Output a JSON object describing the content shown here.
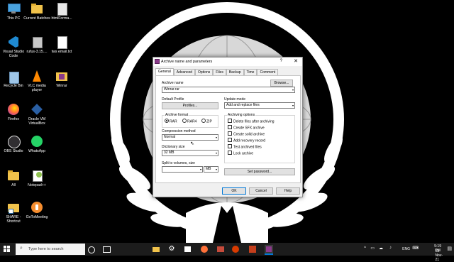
{
  "desktop": {
    "icons": [
      {
        "label": "This PC",
        "icon": "this-pc-icon",
        "color": "#4aa3df"
      },
      {
        "label": "Visual Studio Code",
        "icon": "vscode-icon",
        "color": "#1f8ad2"
      },
      {
        "label": "Recycle Bin",
        "icon": "recycle-bin-icon",
        "color": "#9ec6e8"
      },
      {
        "label": "Firefox",
        "icon": "firefox-icon",
        "color": "#ff7139"
      },
      {
        "label": "OBS Studio",
        "icon": "obs-studio-icon",
        "color": "#302e31"
      },
      {
        "label": "All",
        "icon": "folder-icon",
        "color": "#f1c34b"
      },
      {
        "label": "SHARE - Shortcut",
        "icon": "folder-shortcut-icon",
        "color": "#f1c34b"
      },
      {
        "label": "Current Batches",
        "icon": "folder-icon",
        "color": "#f1c34b"
      },
      {
        "label": "rufus-3.15....",
        "icon": "rufus-icon",
        "color": "#c7c7c7"
      },
      {
        "label": "VLC media player",
        "icon": "vlc-icon",
        "color": "#ff8800"
      },
      {
        "label": "Oracle VM VirtualBox",
        "icon": "virtualbox-icon",
        "color": "#2a5fa3"
      },
      {
        "label": "WhatsApp",
        "icon": "whatsapp-icon",
        "color": "#25d366"
      },
      {
        "label": "Notepad++",
        "icon": "notepadpp-icon",
        "color": "#90c250"
      },
      {
        "label": "GoToMeeting",
        "icon": "gotomeeting-icon",
        "color": "#f68d2e"
      },
      {
        "label": "htmlForma...",
        "icon": "html-file-icon",
        "color": "#e8e8e8"
      },
      {
        "label": "tws email.txt",
        "icon": "text-file-icon",
        "color": "#ffffff"
      },
      {
        "label": "Winrar",
        "icon": "winrar-folder-icon",
        "color": "#f1c34b"
      }
    ]
  },
  "dialog": {
    "title": "Archive name and parameters",
    "help": "?",
    "close": "✕",
    "tabs": [
      "General",
      "Advanced",
      "Options",
      "Files",
      "Backup",
      "Time",
      "Comment"
    ],
    "archive_name_label": "Archive name",
    "archive_name_value": "Winrar.rar",
    "browse": "Browse...",
    "default_profile_label": "Default Profile",
    "profiles": "Profiles...",
    "update_mode_label": "Update mode",
    "update_mode_value": "Add and replace files",
    "archive_format_label": "Archive format",
    "formats": [
      "RAR",
      "RAR4",
      "ZIP"
    ],
    "compression_label": "Compression method",
    "compression_value": "Normal",
    "dictionary_label": "Dictionary size",
    "dictionary_value": "32 MB",
    "split_label": "Split to volumes, size",
    "split_unit": "MB",
    "archiving_options_label": "Archiving options",
    "options": [
      "Delete files after archiving",
      "Create SFX archive",
      "Create solid archive",
      "Add recovery record",
      "Test archived files",
      "Lock archive"
    ],
    "set_password": "Set password...",
    "ok": "OK",
    "cancel": "Cancel",
    "help_button": "Help"
  },
  "taskbar": {
    "search_placeholder": "Type here to search",
    "language": "ENG",
    "time": "5:19 PM",
    "date": "18-Nov-21",
    "colors": {
      "bar": "#1c1c1c",
      "accent": "#0078d7"
    }
  }
}
